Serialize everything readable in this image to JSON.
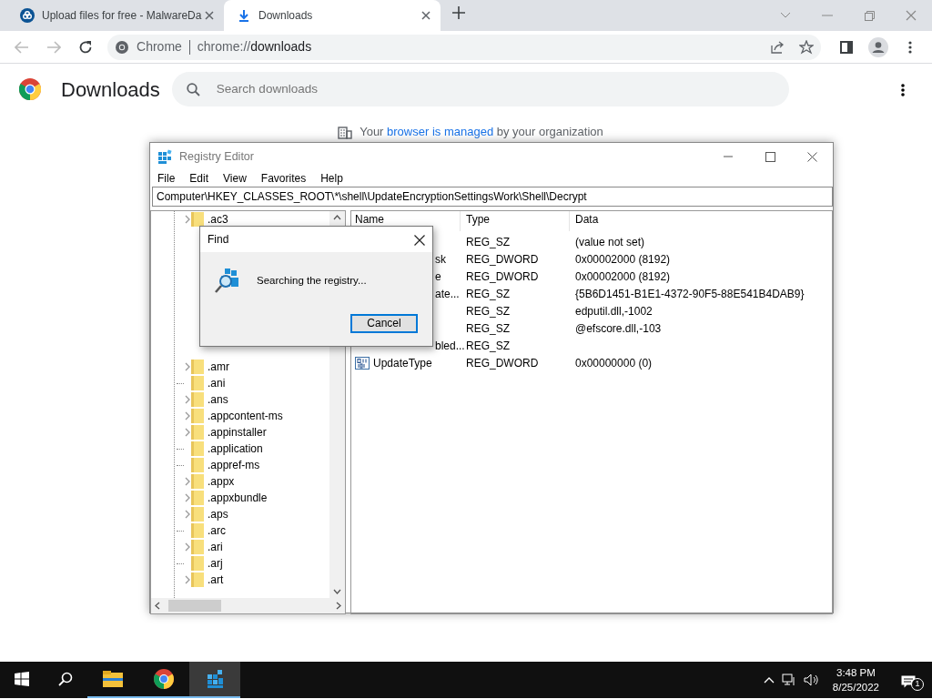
{
  "browser": {
    "tabs": [
      {
        "title": "Upload files for free - MalwareDa",
        "selected": false,
        "kind": "cloud"
      },
      {
        "title": "Downloads",
        "selected": true,
        "kind": "download"
      }
    ],
    "omnibox": {
      "site": "Chrome",
      "url_host": "chrome://",
      "url_path": "downloads"
    }
  },
  "page": {
    "title": "Downloads",
    "search": {
      "placeholder": "Search downloads"
    },
    "managed_notice": {
      "prefix": "Your ",
      "link": "browser is managed",
      "suffix": " by your organization"
    }
  },
  "regedit": {
    "title": "Registry Editor",
    "menu": [
      "File",
      "Edit",
      "View",
      "Favorites",
      "Help"
    ],
    "address": "Computer\\HKEY_CLASSES_ROOT\\*\\shell\\UpdateEncryptionSettingsWork\\Shell\\Decrypt",
    "tree_top": [
      {
        "label": ".ac3",
        "has_children": true
      }
    ],
    "tree": [
      {
        "label": ".amr",
        "has_children": true
      },
      {
        "label": ".ani",
        "has_children": false
      },
      {
        "label": ".ans",
        "has_children": true
      },
      {
        "label": ".appcontent-ms",
        "has_children": true
      },
      {
        "label": ".appinstaller",
        "has_children": true
      },
      {
        "label": ".application",
        "has_children": false
      },
      {
        "label": ".appref-ms",
        "has_children": false
      },
      {
        "label": ".appx",
        "has_children": true
      },
      {
        "label": ".appxbundle",
        "has_children": true
      },
      {
        "label": ".aps",
        "has_children": true
      },
      {
        "label": ".arc",
        "has_children": false
      },
      {
        "label": ".ari",
        "has_children": true
      },
      {
        "label": ".arj",
        "has_children": false
      },
      {
        "label": ".art",
        "has_children": true
      }
    ],
    "columns": [
      "Name",
      "Type",
      "Data"
    ],
    "values": [
      {
        "kind": "hidden",
        "type": "REG_SZ",
        "data": "(value not set)"
      },
      {
        "kind": "partial",
        "name": "sk",
        "type": "REG_DWORD",
        "data": "0x00002000 (8192)"
      },
      {
        "kind": "partial",
        "name": "e",
        "type": "REG_DWORD",
        "data": "0x00002000 (8192)"
      },
      {
        "kind": "partial",
        "name": "ate...",
        "type": "REG_SZ",
        "data": "{5B6D1451-B1E1-4372-90F5-88E541B4DAB9}"
      },
      {
        "kind": "hidden",
        "type": "REG_SZ",
        "data": "edputil.dll,-1002"
      },
      {
        "kind": "hidden",
        "type": "REG_SZ",
        "data": "@efscore.dll,-103"
      },
      {
        "kind": "partial",
        "name": "bled...",
        "type": "REG_SZ"
      },
      {
        "kind": "full",
        "name": "UpdateType",
        "type": "REG_DWORD",
        "data": "0x00000000 (0)"
      }
    ],
    "find_dialog": {
      "title": "Find",
      "message": "Searching the registry...",
      "button": "Cancel"
    }
  },
  "taskbar": {
    "apps": [
      {
        "kind": "explorer",
        "selected": false
      },
      {
        "kind": "chrome",
        "selected": false
      },
      {
        "kind": "regedit",
        "selected": true
      }
    ],
    "time": "3:48 PM",
    "date": "8/25/2022",
    "notifications": "1"
  }
}
